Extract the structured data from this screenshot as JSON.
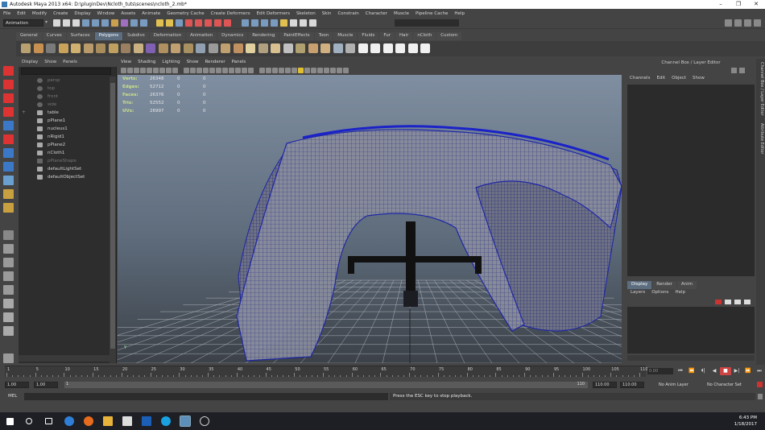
{
  "window": {
    "title": "Autodesk Maya 2013 x64: D:\\pluginDev\\Ncloth_tuts\\scenes\\ncloth_2.mb*",
    "controls": [
      "–",
      "❐",
      "✕"
    ]
  },
  "menubar": [
    "File",
    "Edit",
    "Modify",
    "Create",
    "Display",
    "Window",
    "Assets",
    "Animate",
    "Geometry Cache",
    "Create Deformers",
    "Edit Deformers",
    "Skeleton",
    "Skin",
    "Constrain",
    "Character",
    "Muscle",
    "Pipeline Cache",
    "Help"
  ],
  "status": {
    "mode": "Animation"
  },
  "shelf": {
    "tabs": [
      "General",
      "Curves",
      "Surfaces",
      "Polygons",
      "Subdivs",
      "Deformation",
      "Animation",
      "Dynamics",
      "Rendering",
      "PaintEffects",
      "Toon",
      "Muscle",
      "Fluids",
      "Fur",
      "Hair",
      "nCloth",
      "Custom"
    ],
    "active_tab": "Polygons"
  },
  "outliner": {
    "menu": [
      "Display",
      "Show",
      "Panels"
    ],
    "items": [
      {
        "label": "persp",
        "dim": true
      },
      {
        "label": "top",
        "dim": true
      },
      {
        "label": "front",
        "dim": true
      },
      {
        "label": "side",
        "dim": true
      },
      {
        "label": "table",
        "dim": false,
        "expand": "+"
      },
      {
        "label": "pPlane1",
        "dim": false
      },
      {
        "label": "nucleus1",
        "dim": false
      },
      {
        "label": "nRigid1",
        "dim": false
      },
      {
        "label": "pPlane2",
        "dim": false
      },
      {
        "label": "nCloth1",
        "dim": false
      },
      {
        "label": "pPlaneShape",
        "dim": true
      },
      {
        "label": "defaultLightSet",
        "dim": false
      },
      {
        "label": "defaultObjectSet",
        "dim": false
      }
    ]
  },
  "viewport": {
    "menu": [
      "View",
      "Shading",
      "Lighting",
      "Show",
      "Renderer",
      "Panels"
    ],
    "hud": [
      {
        "label": "Verts:",
        "value": "26348",
        "a": "0",
        "b": "0"
      },
      {
        "label": "Edges:",
        "value": "52712",
        "a": "0",
        "b": "0"
      },
      {
        "label": "Faces:",
        "value": "26376",
        "a": "0",
        "b": "0"
      },
      {
        "label": "Tris:",
        "value": "52552",
        "a": "0",
        "b": "0"
      },
      {
        "label": "UVs:",
        "value": "26997",
        "a": "0",
        "b": "0"
      }
    ],
    "axis_label": "Y"
  },
  "channelbox": {
    "title": "Channel Box / Layer Editor",
    "menu": [
      "Channels",
      "Edit",
      "Object",
      "Show"
    ]
  },
  "layer_editor": {
    "tabs": [
      "Display",
      "Render",
      "Anim"
    ],
    "active_tab": "Display",
    "menu": [
      "Layers",
      "Options",
      "Help"
    ]
  },
  "side_tabs": [
    "Channel Box / Layer Editor",
    "Attribute Editor"
  ],
  "timeline": {
    "ticks": [
      "1",
      "5",
      "10",
      "15",
      "20",
      "25",
      "30",
      "35",
      "40",
      "45",
      "50",
      "55",
      "60",
      "65",
      "70",
      "75",
      "80",
      "85",
      "90",
      "95",
      "100",
      "105",
      "110"
    ],
    "current_frame": "0.00",
    "playback": [
      "⏮",
      "⏪",
      "⏴|",
      "◀",
      "■",
      "▶|",
      "⏩",
      "⏭"
    ]
  },
  "range": {
    "start": "1.00",
    "start_inner": "1.00",
    "slider_start": "1",
    "slider_end": "110",
    "end_inner": "110.00",
    "end": "110.00",
    "anim_layer": "No Anim Layer",
    "character_set": "No Character Set"
  },
  "commandline": {
    "label": "MEL",
    "output": "Press the ESC key to stop playback."
  },
  "taskbar": {
    "time": "6:43 PM",
    "date": "1/18/2017"
  },
  "colors": {
    "accent_tab": "#5c6d80",
    "mesh_blue": "#1a22a8",
    "hud_label": "#c8e08a"
  }
}
